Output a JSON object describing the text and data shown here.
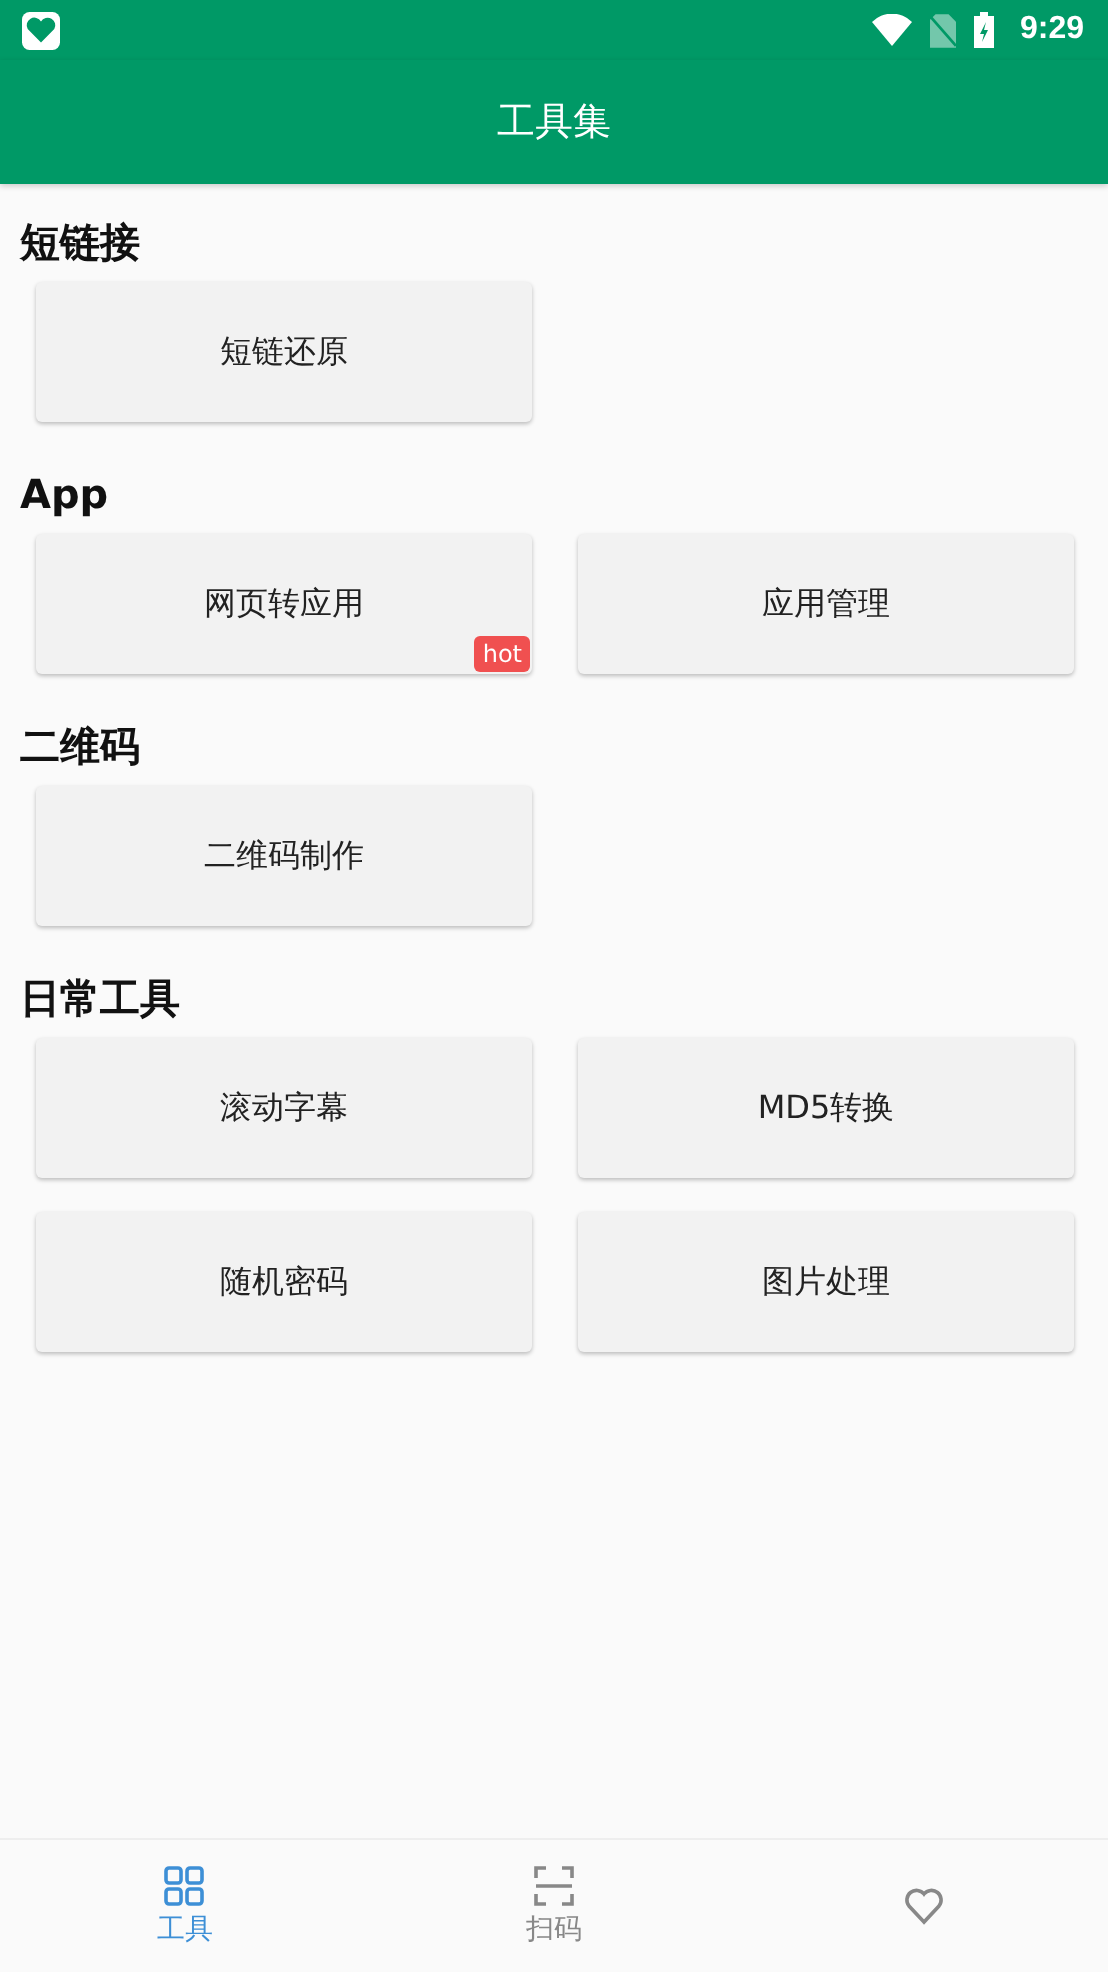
{
  "status_bar": {
    "time": "9:29"
  },
  "app_bar": {
    "title": "工具集"
  },
  "sections": [
    {
      "title": "短链接",
      "tools": [
        {
          "label": "短链还原"
        }
      ]
    },
    {
      "title": "App",
      "tools": [
        {
          "label": "网页转应用",
          "badge": "hot"
        },
        {
          "label": "应用管理"
        }
      ]
    },
    {
      "title": "二维码",
      "tools": [
        {
          "label": "二维码制作"
        }
      ]
    },
    {
      "title": "日常工具",
      "tools": [
        {
          "label": "滚动字幕"
        },
        {
          "label": "MD5转换"
        },
        {
          "label": "随机密码"
        },
        {
          "label": "图片处理"
        }
      ]
    }
  ],
  "bottom_nav": [
    {
      "kind": "grid",
      "label": "工具",
      "selected": true
    },
    {
      "kind": "scan",
      "label": "扫码",
      "selected": false
    },
    {
      "kind": "heart",
      "selected": false
    }
  ]
}
